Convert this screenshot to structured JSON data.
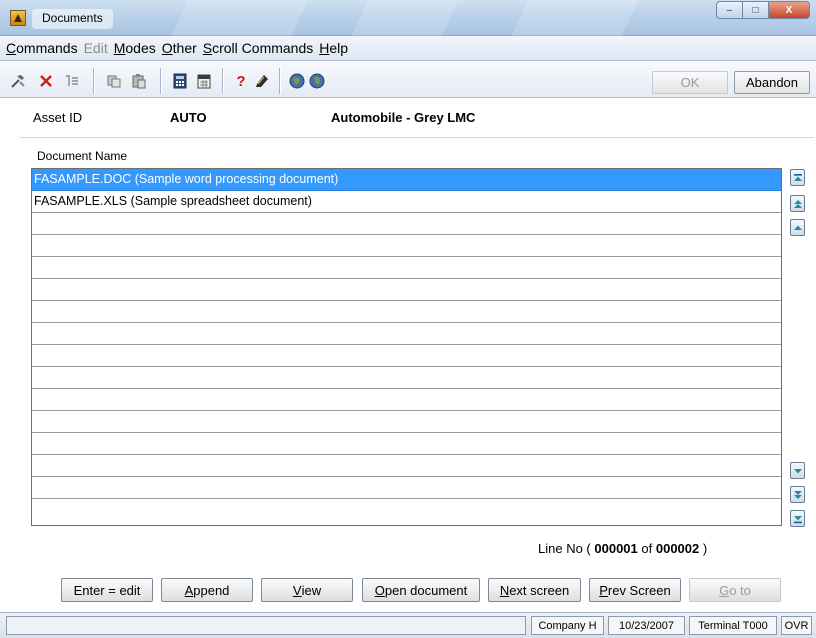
{
  "window": {
    "title": "Documents",
    "controls": {
      "minimize": "–",
      "maximize": "□",
      "close": "X"
    }
  },
  "menu": [
    {
      "label": "Commands",
      "underline": "C",
      "rest": "ommands",
      "enabled": true
    },
    {
      "label": "Edit",
      "underline": "",
      "rest": "Edit",
      "enabled": false
    },
    {
      "label": "Modes",
      "underline": "M",
      "rest": "odes",
      "enabled": true
    },
    {
      "label": "Other",
      "underline": "O",
      "rest": "ther",
      "enabled": true
    },
    {
      "label": "Scroll Commands",
      "underline": "S",
      "rest": "croll Commands",
      "enabled": true
    },
    {
      "label": "Help",
      "underline": "H",
      "rest": "elp",
      "enabled": true
    }
  ],
  "toolbar": {
    "icons": [
      "hammer-icon",
      "delete-x-icon",
      "clear-icon",
      "copy-icon",
      "paste-icon",
      "calculator-icon",
      "calendar-icon",
      "help-icon",
      "notes-icon",
      "back-globe-icon",
      "forward-globe-icon"
    ],
    "ok_label": "OK",
    "abandon_label": "Abandon"
  },
  "header": {
    "asset_label": "Asset ID",
    "asset_id": "AUTO",
    "asset_description": "Automobile - Grey LMC"
  },
  "grid": {
    "column_header": "Document Name",
    "rows": [
      "FASAMPLE.DOC (Sample word processing document)",
      "FASAMPLE.XLS (Sample spreadsheet document)",
      "",
      "",
      "",
      "",
      "",
      "",
      "",
      "",
      "",
      "",
      "",
      "",
      "",
      ""
    ],
    "selected_index": 0
  },
  "line_info": {
    "prefix": "Line No (",
    "current": "000001",
    "of_label": "of",
    "total": "000002",
    "suffix": ")"
  },
  "buttons": [
    {
      "label": "Enter = edit",
      "underline": "",
      "after": "",
      "enabled": true
    },
    {
      "label": "Append",
      "underline": "A",
      "after": "ppend",
      "enabled": true
    },
    {
      "label": "View",
      "underline": "V",
      "after": "iew",
      "enabled": true
    },
    {
      "label": "Open document",
      "underline": "O",
      "after": "pen document",
      "enabled": true
    },
    {
      "label": "Next screen",
      "underline": "N",
      "after": "ext screen",
      "enabled": true
    },
    {
      "label": "Prev Screen",
      "underline": "P",
      "after": "rev Screen",
      "enabled": true
    },
    {
      "label": "Go to",
      "underline": "G",
      "after": "o to",
      "enabled": false
    }
  ],
  "status": {
    "company": "Company H",
    "date": "10/23/2007",
    "terminal": "Terminal T000",
    "mode": "OVR"
  }
}
